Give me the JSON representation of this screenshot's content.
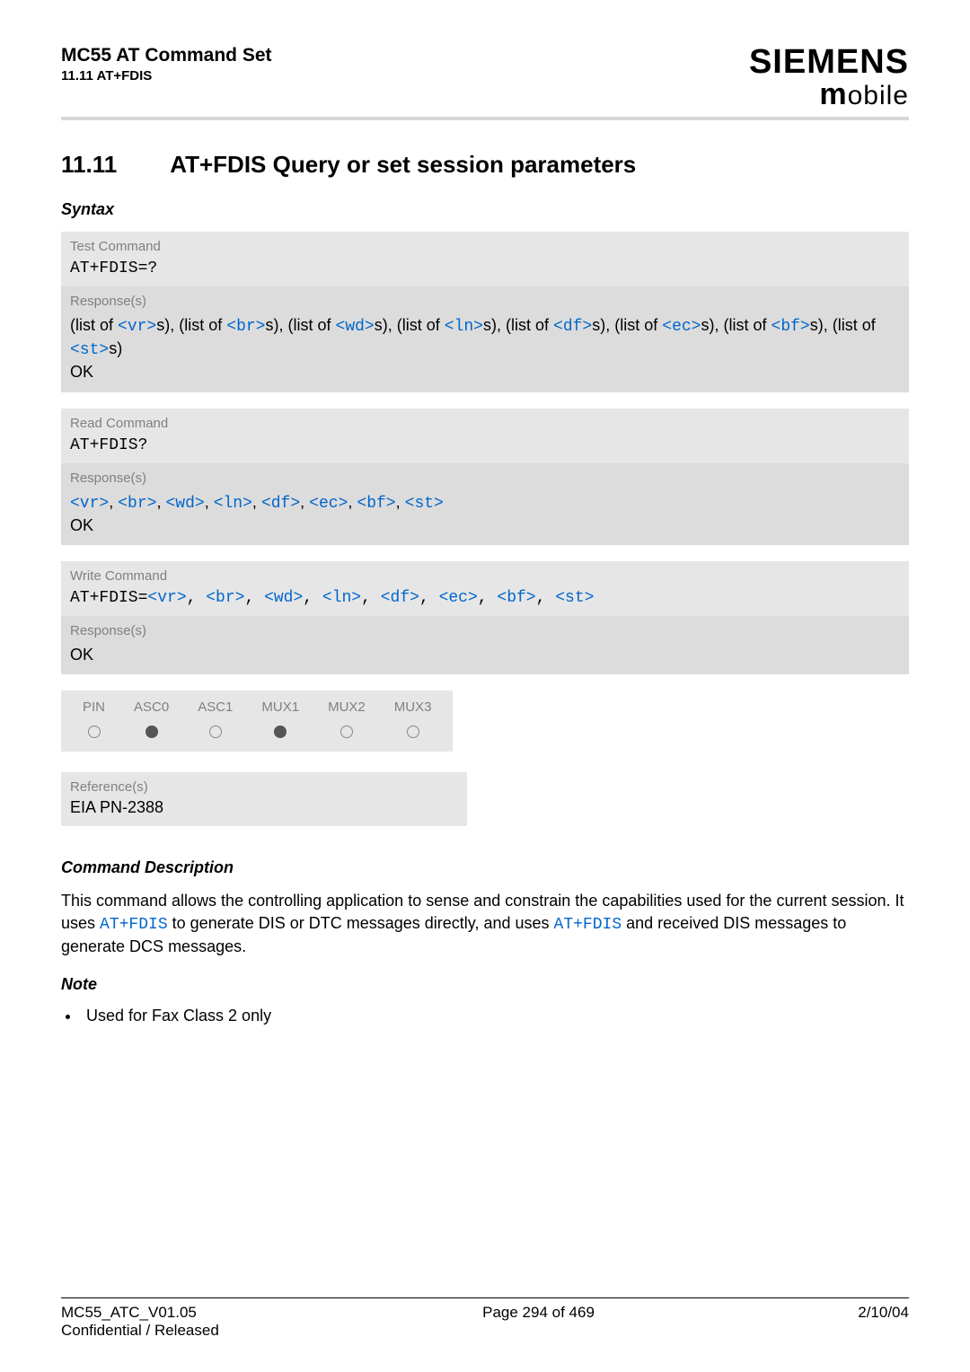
{
  "header": {
    "doc_title": "MC55 AT Command Set",
    "section_ref": "11.11 AT+FDIS",
    "brand": "SIEMENS",
    "brand_sub": "mobile"
  },
  "title": {
    "number": "11.11",
    "text": "AT+FDIS   Query or set session parameters"
  },
  "syntax_label": "Syntax",
  "blocks": {
    "test": {
      "label": "Test Command",
      "code": "AT+FDIS=?",
      "resp_label": "Response(s)",
      "resp_prefix_listof": "(list of ",
      "resp_suffix_s": "s)",
      "params": [
        "vr",
        "br",
        "wd",
        "ln",
        "df",
        "ec",
        "bf",
        "st"
      ],
      "ok": "OK"
    },
    "read": {
      "label": "Read Command",
      "code": "AT+FDIS?",
      "resp_label": "Response(s)",
      "params": [
        "vr",
        "br",
        "wd",
        "ln",
        "df",
        "ec",
        "bf",
        "st"
      ],
      "ok": "OK"
    },
    "write": {
      "label": "Write Command",
      "code_prefix": "AT+FDIS=",
      "params": [
        "vr",
        "br",
        "wd",
        "ln",
        "df",
        "ec",
        "bf",
        "st"
      ],
      "resp_label": "Response(s)",
      "ok": "OK"
    }
  },
  "support": {
    "headers": [
      "PIN",
      "ASC0",
      "ASC1",
      "MUX1",
      "MUX2",
      "MUX3"
    ],
    "values": [
      "open",
      "filled",
      "open",
      "filled",
      "open",
      "open"
    ]
  },
  "reference": {
    "label": "Reference(s)",
    "text": "EIA PN-2388"
  },
  "description": {
    "heading": "Command Description",
    "text_pre": "This command allows the controlling application to sense and constrain the capabilities used for the current session. It uses ",
    "cmd1": "AT+FDIS",
    "text_mid": " to generate DIS or DTC messages directly, and uses ",
    "cmd2": "AT+FDIS",
    "text_post": " and received DIS messages to generate DCS messages."
  },
  "note": {
    "heading": "Note",
    "items": [
      "Used for Fax Class 2 only"
    ]
  },
  "footer": {
    "left1": "MC55_ATC_V01.05",
    "left2": "Confidential / Released",
    "center": "Page 294 of 469",
    "right": "2/10/04"
  }
}
